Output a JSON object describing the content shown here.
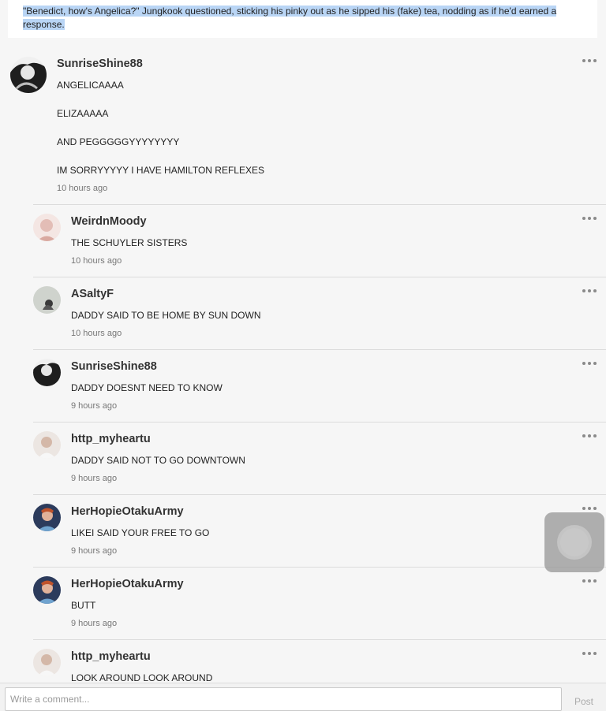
{
  "story_excerpt": {
    "line1": "\"Benedict, how's Angelica?\" Jungkook questioned, sticking his pinky out as he sipped his (fake) tea, nodding as if he'd earned a",
    "line2": "response."
  },
  "comments": [
    {
      "username": "SunriseShine88",
      "lines": [
        "ANGELICAAAA",
        "ELIZAAAAA",
        "AND PEGGGGGYYYYYYYY",
        "IM SORRYYYYY I HAVE HAMILTON REFLEXES"
      ],
      "time": "10 hours ago",
      "avatar_color": "#2b2b2b"
    },
    {
      "username": "WeirdnMoody",
      "lines": [
        "THE SCHUYLER SISTERS"
      ],
      "time": "10 hours ago",
      "avatar_color": "#e8c9c4"
    },
    {
      "username": "ASaltyF",
      "lines": [
        "DADDY SAID TO BE HOME BY SUN DOWN"
      ],
      "time": "10 hours ago",
      "avatar_color": "#c9cfc8"
    },
    {
      "username": "SunriseShine88",
      "lines": [
        "DADDY DOESNT NEED TO KNOW"
      ],
      "time": "9 hours ago",
      "avatar_color": "#2b2b2b"
    },
    {
      "username": "http_myheartu",
      "lines": [
        "DADDY SAID NOT TO GO DOWNTOWN"
      ],
      "time": "9 hours ago",
      "avatar_color": "#ddd4cf"
    },
    {
      "username": "HerHopieOtakuArmy",
      "lines": [
        "LIKEI SAID YOUR FREE TO GO"
      ],
      "time": "9 hours ago",
      "avatar_color": "#3a4a6a"
    },
    {
      "username": "HerHopieOtakuArmy",
      "lines": [
        "BUTT"
      ],
      "time": "9 hours ago",
      "avatar_color": "#3a4a6a"
    },
    {
      "username": "http_myheartu",
      "lines": [
        "LOOK AROUND LOOK AROUND"
      ],
      "time": "",
      "avatar_color": "#ddd4cf"
    }
  ],
  "composer": {
    "placeholder": "Write a comment...",
    "post_label": "Post"
  }
}
